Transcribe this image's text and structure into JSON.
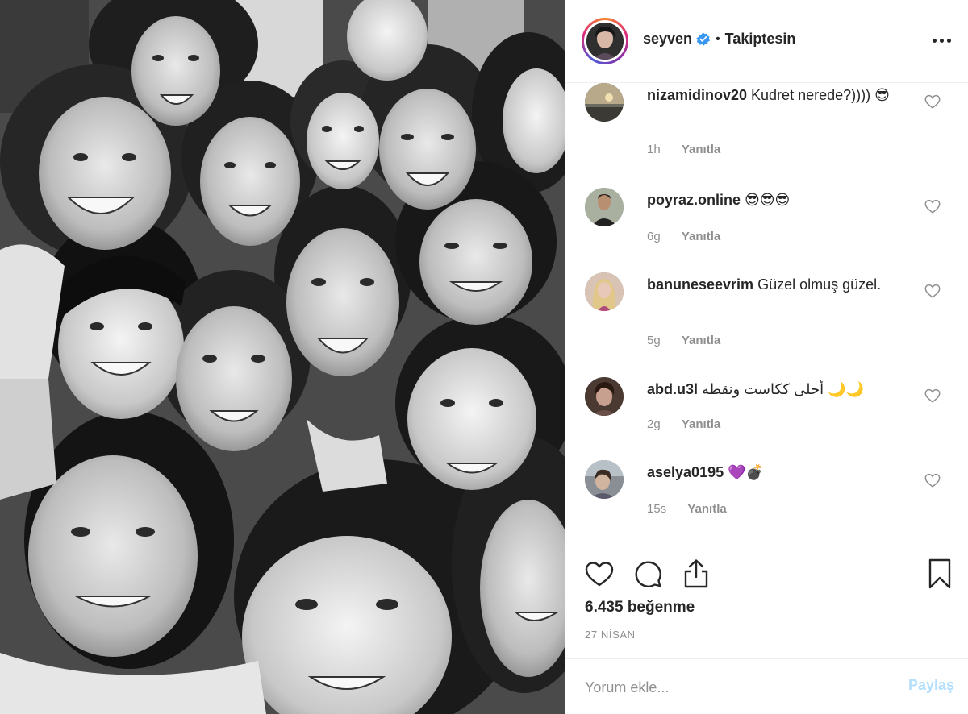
{
  "post": {
    "photo_alt": "",
    "header": {
      "username": "seyven",
      "verified": true,
      "separator": "•",
      "follow_status": "Takiptesin",
      "more_icon": "more-horizontal-icon"
    },
    "comments": [
      {
        "username": "nizamidinov20",
        "text": "Kudret nerede?)))) 😎",
        "time": "1h",
        "reply_label": "Yanıtla"
      },
      {
        "username": "poyraz.online",
        "text": "😎😎😎",
        "time": "6g",
        "reply_label": "Yanıtla"
      },
      {
        "username": "banuneseevrim",
        "text": "Güzel olmuş güzel.",
        "time": "5g",
        "reply_label": "Yanıtla"
      },
      {
        "username": "abd.u3l",
        "text": "أحلى ككاست ونقطه 🌙🌙",
        "time": "2g",
        "reply_label": "Yanıtla"
      },
      {
        "username": "aselya0195",
        "text": "💜💣",
        "time": "15s",
        "reply_label": "Yanıtla"
      }
    ],
    "actions": {
      "like_icon": "heart-icon",
      "comment_icon": "comment-bubble-icon",
      "share_icon": "share-icon",
      "save_icon": "bookmark-icon"
    },
    "likes_text": "6.435 beğenme",
    "date_text": "27 NİSAN",
    "add_comment": {
      "placeholder": "Yorum ekle...",
      "post_label": "Paylaş"
    },
    "colors": {
      "text": "#262626",
      "muted": "#8e8e8e",
      "verified": "#3897f0",
      "post_disabled": "#b2dffc",
      "border": "#efefef"
    }
  }
}
